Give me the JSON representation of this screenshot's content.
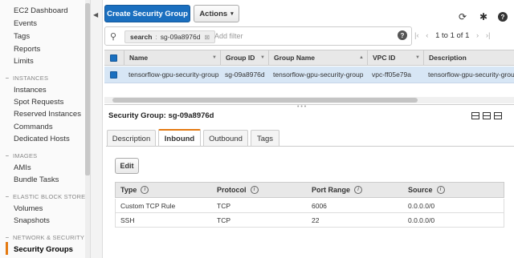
{
  "sidebar": {
    "top_links": [
      "EC2 Dashboard",
      "Events",
      "Tags",
      "Reports",
      "Limits"
    ],
    "sections": [
      {
        "title": "INSTANCES",
        "links": [
          "Instances",
          "Spot Requests",
          "Reserved Instances",
          "Commands",
          "Dedicated Hosts"
        ]
      },
      {
        "title": "IMAGES",
        "links": [
          "AMIs",
          "Bundle Tasks"
        ]
      },
      {
        "title": "ELASTIC BLOCK STORE",
        "links": [
          "Volumes",
          "Snapshots"
        ]
      },
      {
        "title": "NETWORK & SECURITY",
        "links": [
          "Security Groups"
        ]
      }
    ],
    "section_icon": "−",
    "active_link": "Security Groups"
  },
  "toolbar": {
    "create_label": "Create Security Group",
    "actions_label": "Actions",
    "caret": "▾",
    "refresh_icon": "⟳",
    "settings_icon": "✱",
    "help_icon": "?"
  },
  "filter": {
    "chip_key": "search",
    "chip_sep": ":",
    "chip_value": "sg-09a8976d",
    "chip_remove": "⊠",
    "placeholder": "Add filter",
    "help": "?"
  },
  "pagination": {
    "first": "|‹",
    "prev": "‹",
    "text": "1 to 1 of 1",
    "next": "›",
    "last": "›|"
  },
  "table": {
    "columns": [
      "Name",
      "Group ID",
      "Group Name",
      "VPC ID",
      "Description"
    ],
    "rows": [
      [
        "tensorflow-gpu-security-group",
        "sg-09a8976d",
        "tensorflow-gpu-security-group",
        "vpc-ff05e79a",
        "tensorflow-gpu-security-group"
      ]
    ]
  },
  "detail": {
    "title_label": "Security Group:",
    "title_value": "sg-09a8976d",
    "tabs": [
      "Description",
      "Inbound",
      "Outbound",
      "Tags"
    ],
    "active_tab": "Inbound",
    "edit_label": "Edit",
    "rules_columns": [
      "Type",
      "Protocol",
      "Port Range",
      "Source"
    ],
    "info_glyph": "i",
    "rules": [
      [
        "Custom TCP Rule",
        "TCP",
        "6006",
        "0.0.0.0/0"
      ],
      [
        "SSH",
        "TCP",
        "22",
        "0.0.0.0/0"
      ]
    ]
  },
  "colors": {
    "primary": "#1a6fbf",
    "accent": "#e47911",
    "selected_row": "#d7e6f5"
  }
}
